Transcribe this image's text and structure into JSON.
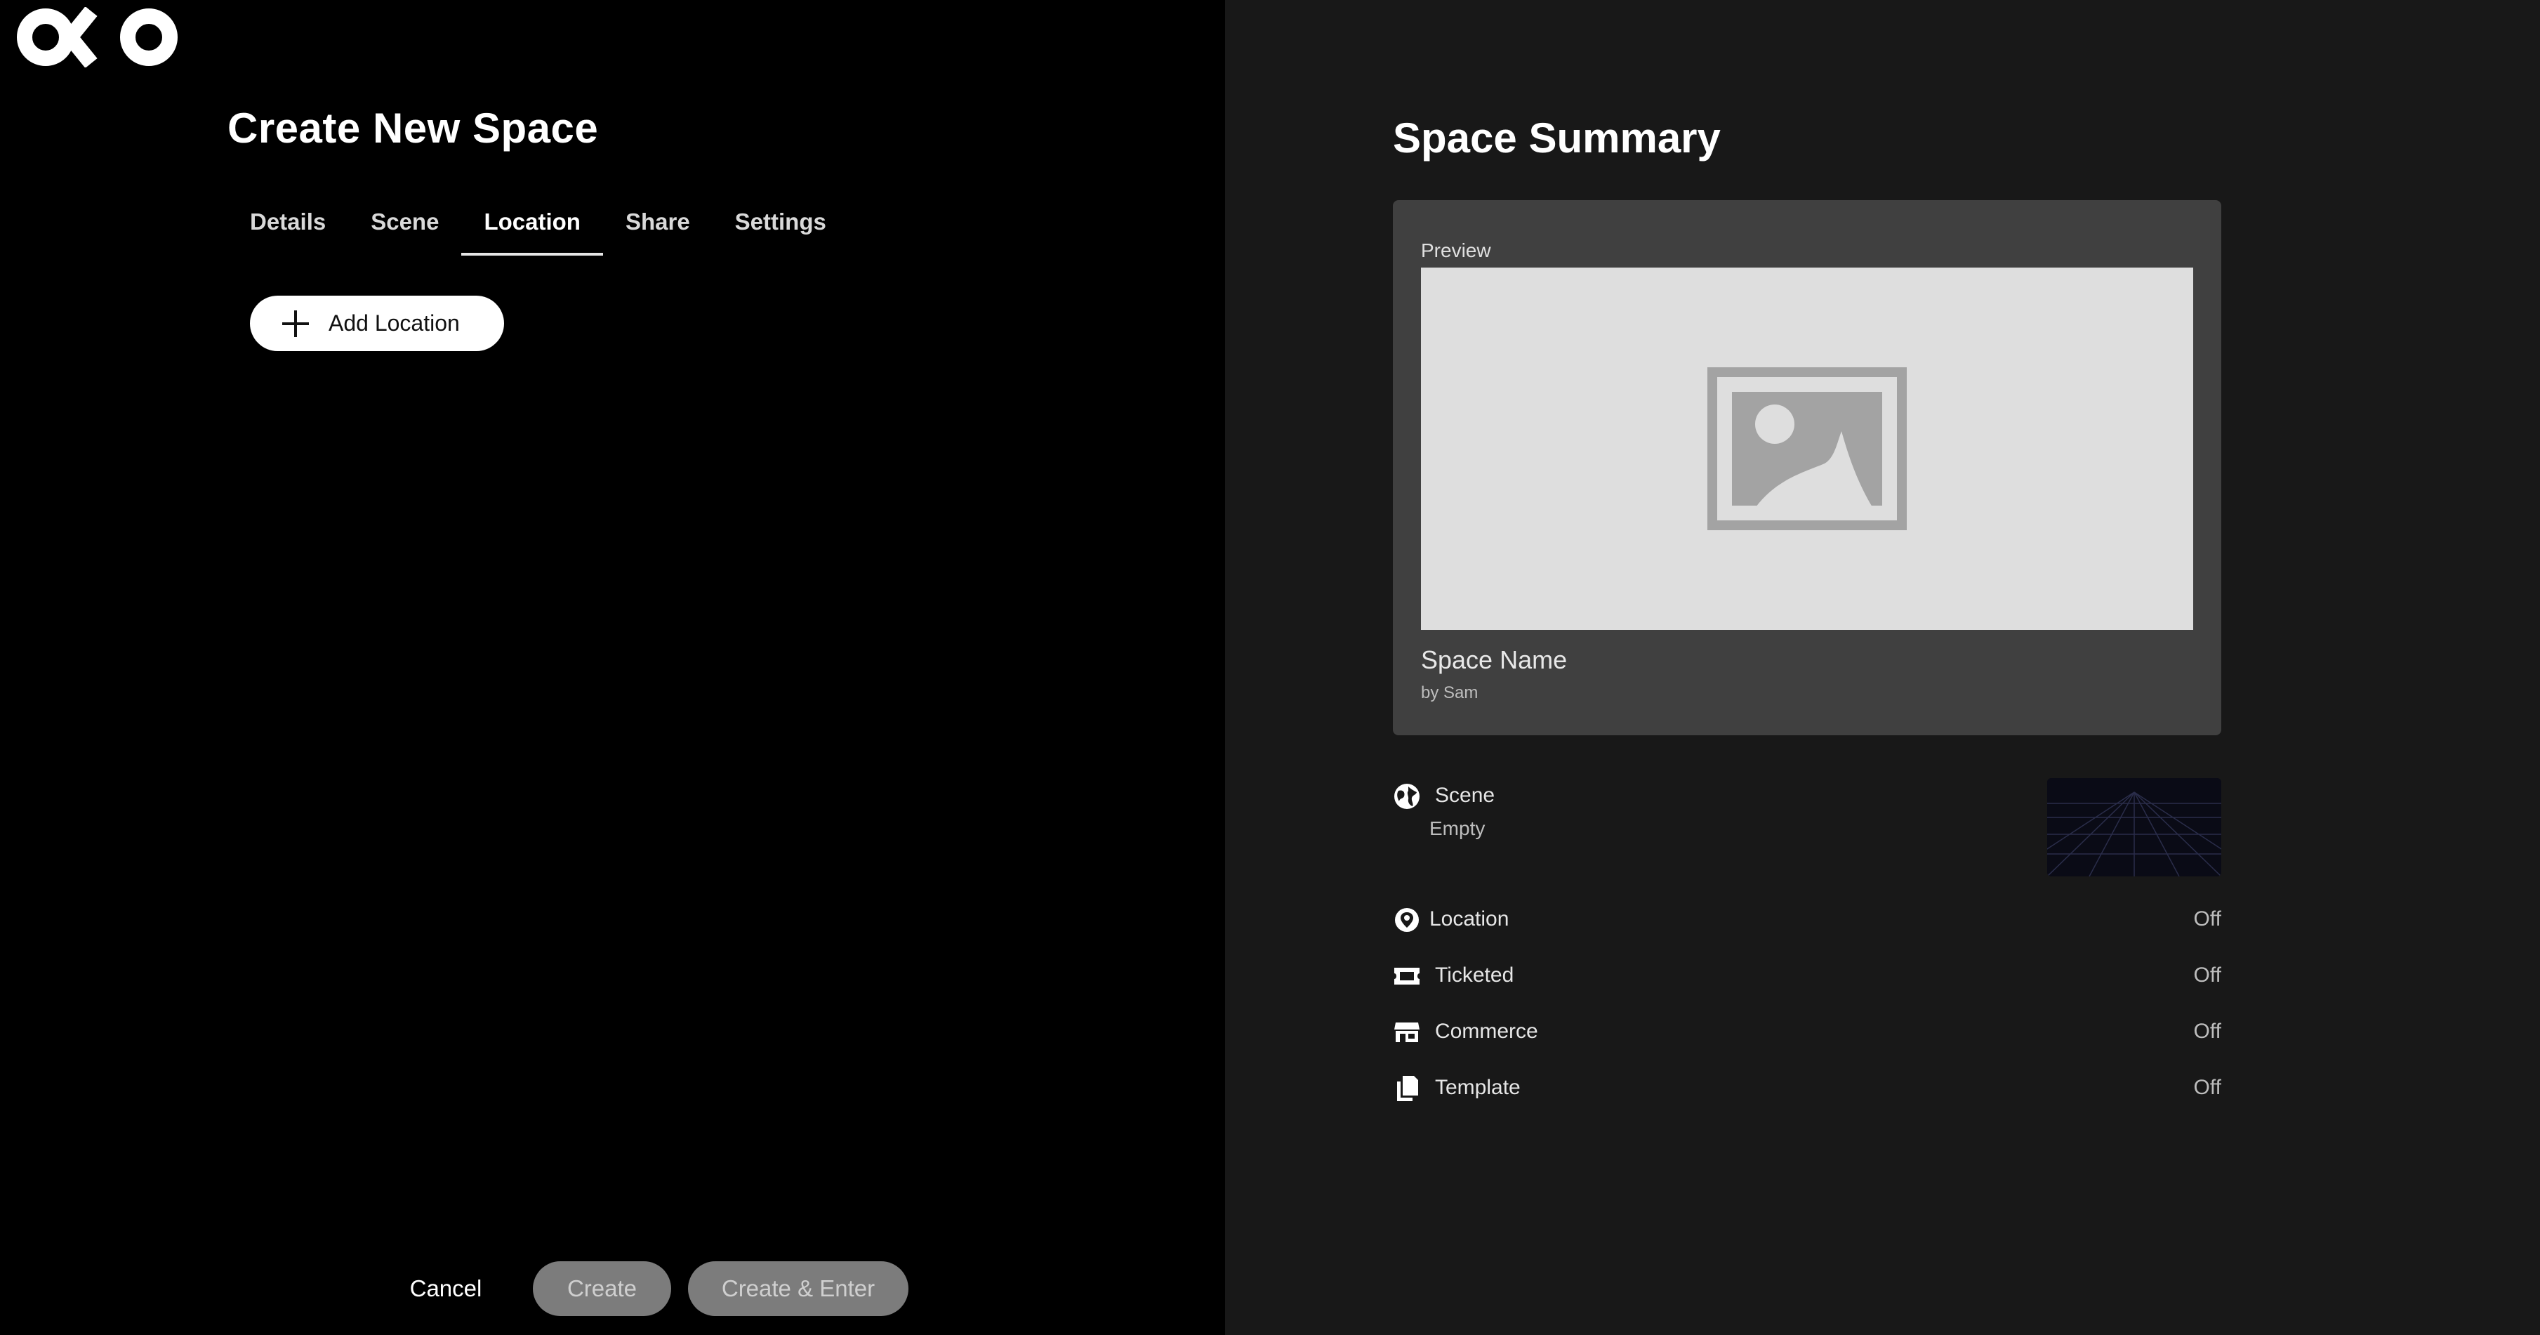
{
  "app": {
    "logo_text": "OKO"
  },
  "create_panel": {
    "title": "Create New Space",
    "tabs": [
      {
        "label": "Details",
        "active": false
      },
      {
        "label": "Scene",
        "active": false
      },
      {
        "label": "Location",
        "active": true
      },
      {
        "label": "Share",
        "active": false
      },
      {
        "label": "Settings",
        "active": false
      }
    ],
    "add_location_label": "Add Location",
    "footer": {
      "cancel_label": "Cancel",
      "create_label": "Create",
      "create_enter_label": "Create & Enter"
    }
  },
  "summary_panel": {
    "title": "Space Summary",
    "preview": {
      "label": "Preview",
      "space_name": "Space Name",
      "author": "by Sam"
    },
    "rows": [
      {
        "icon": "globe-icon",
        "label": "Scene",
        "sub": "Empty",
        "value": ""
      },
      {
        "icon": "location-pin-icon",
        "label": "Location",
        "value": "Off"
      },
      {
        "icon": "ticket-icon",
        "label": "Ticketed",
        "value": "Off"
      },
      {
        "icon": "storefront-icon",
        "label": "Commerce",
        "value": "Off"
      },
      {
        "icon": "copy-template-icon",
        "label": "Template",
        "value": "Off"
      }
    ]
  },
  "colors": {
    "left_bg": "#000000",
    "right_bg": "#181818",
    "card_bg": "#404040",
    "preview_bg": "#dedede",
    "disabled_button": "#7c7c7c"
  }
}
